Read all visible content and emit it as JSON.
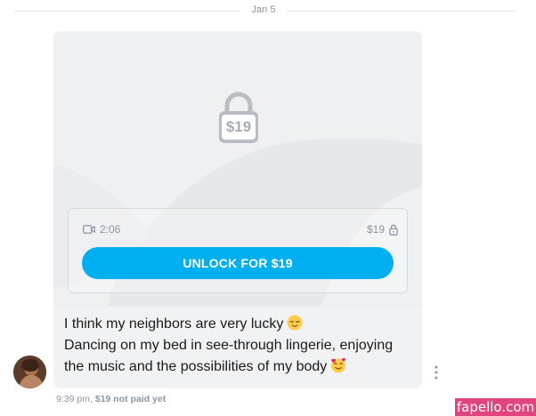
{
  "divider": {
    "date": "Jan 5"
  },
  "media": {
    "locked_price": "$19",
    "video_duration": "2:06",
    "price": "$19",
    "unlock_label": "UNLOCK FOR $19",
    "icons": [
      "video-camera-icon",
      "lock-icon"
    ]
  },
  "message": {
    "line1": "I think my neighbors are very lucky",
    "line1_emoji": "relieved-face-emoji",
    "line2": "Dancing on my bed in see-through lingerie, enjoying",
    "line3": "the music and the possibilities of my body",
    "line3_emoji": "smiling-face-with-hearts-emoji"
  },
  "footer": {
    "time": "9:39 pm,",
    "paid_status": "$19 not paid yet"
  },
  "watermark": "fapello.com",
  "colors": {
    "accent": "#00aff0",
    "muted": "#8a96a3",
    "bubble": "#f1f2f4",
    "watermark_bg": "#e0457b"
  }
}
